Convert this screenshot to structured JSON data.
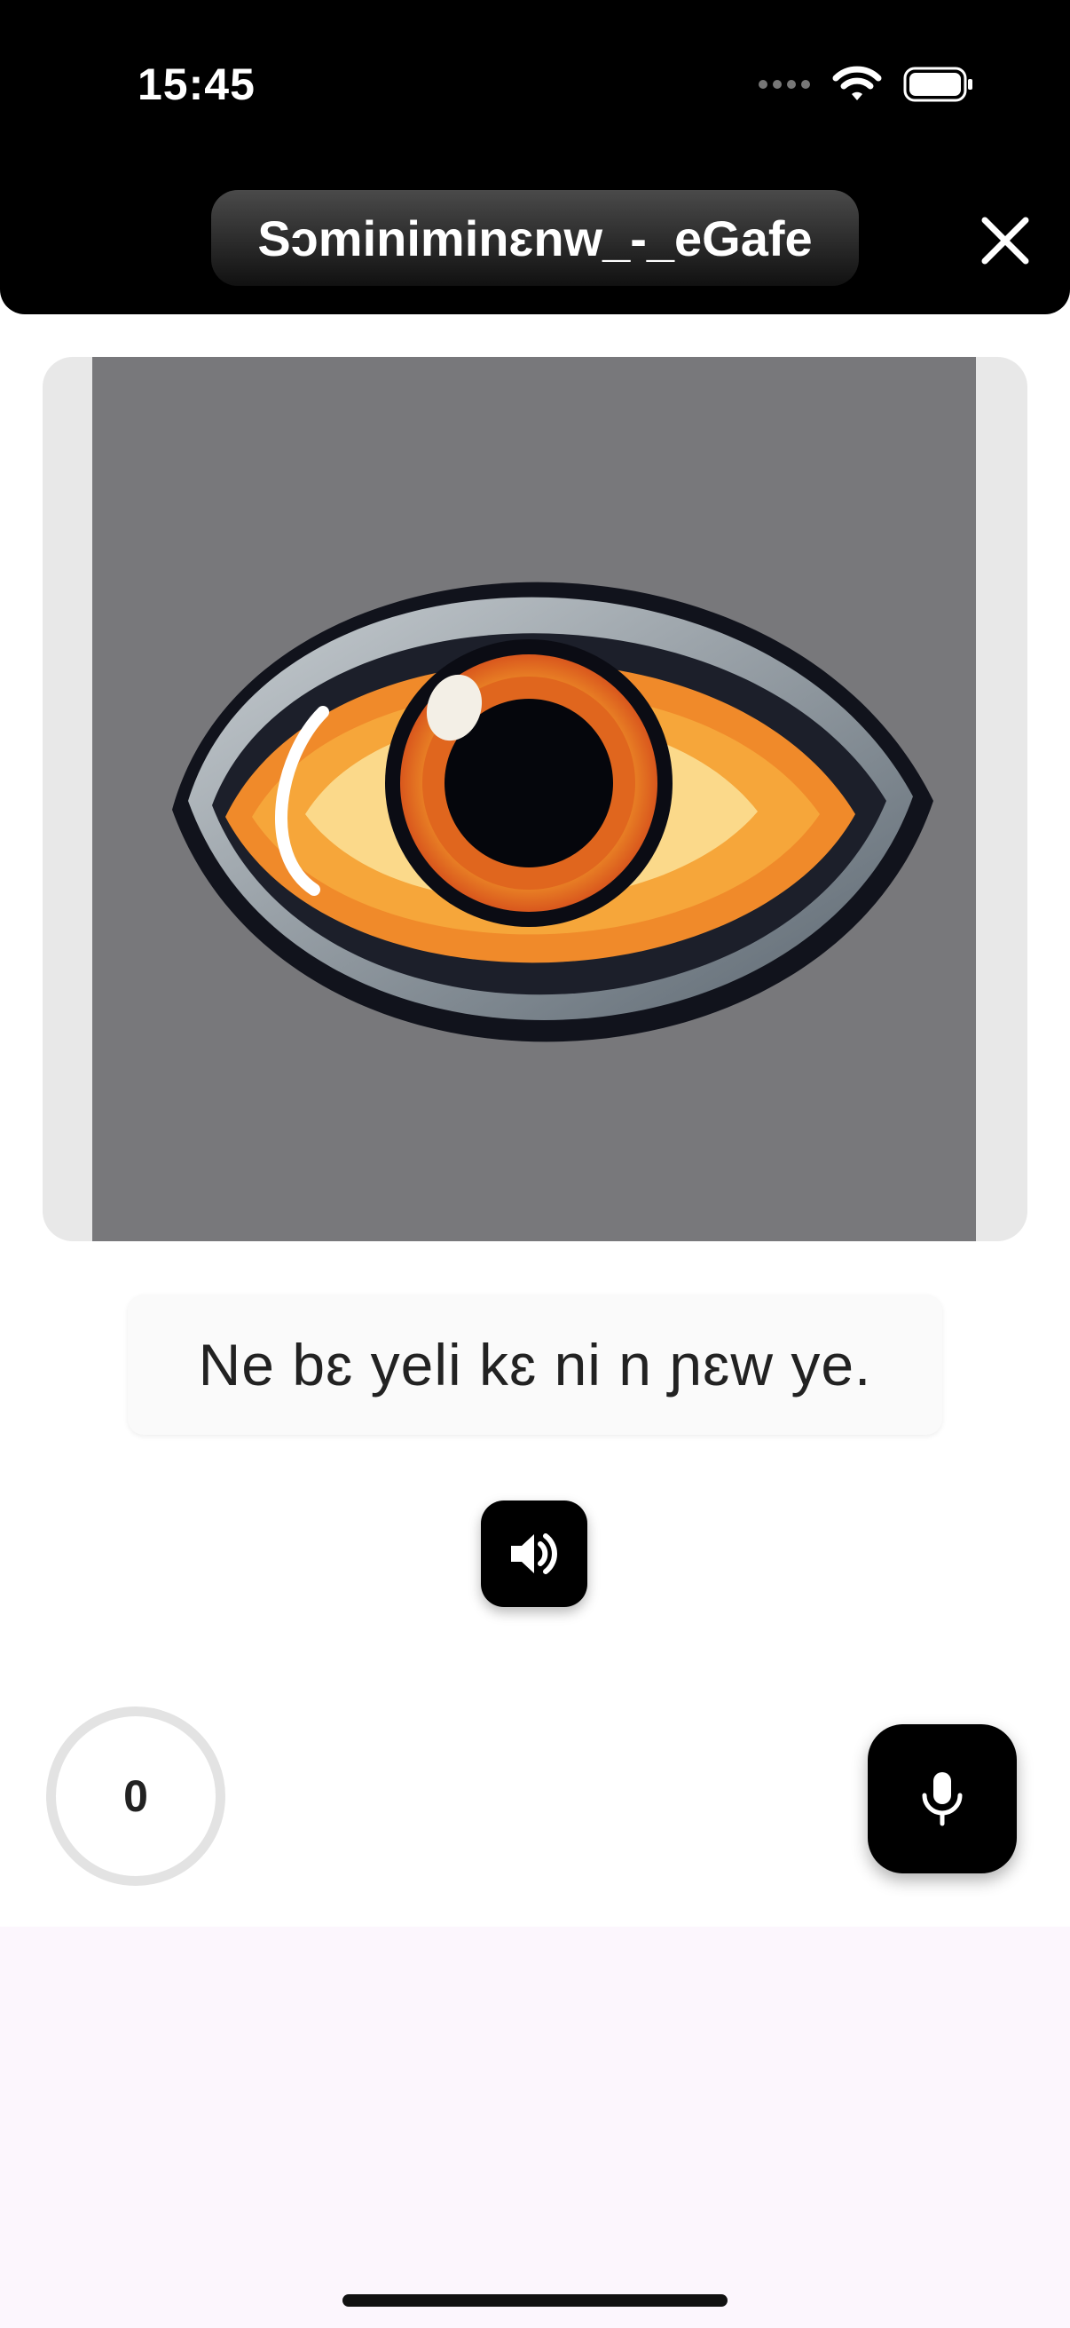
{
  "status_bar": {
    "time": "15:45",
    "icons": [
      "signal-dots-icon",
      "wifi-icon",
      "battery-icon"
    ]
  },
  "header": {
    "title": "Sɔminiminɛnw_-_eGafe",
    "close_icon": "close-icon"
  },
  "image": {
    "description_icon": "eye-illustration"
  },
  "sentence": {
    "text": "Ne bɛ yeli kɛ ni n ɲɛw ye."
  },
  "controls": {
    "speaker_icon": "speaker-icon",
    "score": "0",
    "mic_icon": "microphone-icon"
  },
  "colors": {
    "header_bg": "#000000",
    "accent": "#000000",
    "image_bg": "#78787b",
    "lower_bg": "#fcf6fd"
  }
}
